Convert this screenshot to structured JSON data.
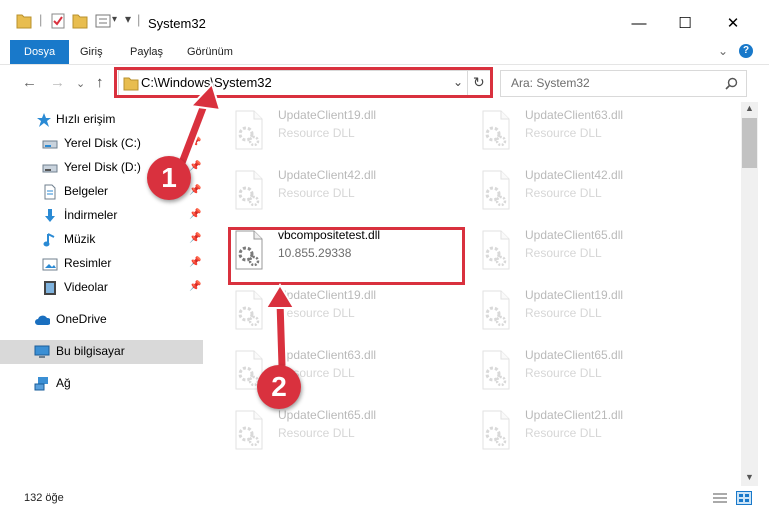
{
  "window": {
    "title": "System32",
    "minimize": "—",
    "maximize": "☐",
    "close": "✕"
  },
  "ribbon": {
    "tabs": [
      "Dosya",
      "Giriş",
      "Paylaş",
      "Görünüm"
    ],
    "help": "?"
  },
  "nav": {
    "back": "←",
    "forward": "→",
    "up": "↑",
    "recent": "⌄"
  },
  "address": {
    "path": "C:\\Windows\\System32"
  },
  "search": {
    "placeholder": "Ara: System32"
  },
  "sidebar": {
    "items": [
      {
        "label": "Hızlı erişim",
        "icon": "star-icon"
      },
      {
        "label": "Yerel Disk (C:)",
        "icon": "drive-icon"
      },
      {
        "label": "Yerel Disk (D:)",
        "icon": "drive-icon"
      },
      {
        "label": "Belgeler",
        "icon": "documents-icon"
      },
      {
        "label": "İndirmeler",
        "icon": "download-icon"
      },
      {
        "label": "Müzik",
        "icon": "music-icon"
      },
      {
        "label": "Resimler",
        "icon": "pictures-icon"
      },
      {
        "label": "Videolar",
        "icon": "video-icon"
      },
      {
        "label": "OneDrive",
        "icon": "cloud-icon"
      },
      {
        "label": "Bu bilgisayar",
        "icon": "computer-icon"
      },
      {
        "label": "Ağ",
        "icon": "network-icon"
      }
    ]
  },
  "files": [
    {
      "name": "UpdateClient19.dll",
      "type": "Resource DLL"
    },
    {
      "name": "UpdateClient63.dll",
      "type": "Resource DLL"
    },
    {
      "name": "UpdateClient42.dll",
      "type": "Resource DLL"
    },
    {
      "name": "UpdateClient42.dll",
      "type": "Resource DLL"
    },
    {
      "name": "vbcompositetest.dll",
      "type": "10.855.29338"
    },
    {
      "name": "UpdateClient65.dll",
      "type": "Resource DLL"
    },
    {
      "name": "UpdateClient19.dll",
      "type": "Resource DLL"
    },
    {
      "name": "UpdateClient19.dll",
      "type": "Resource DLL"
    },
    {
      "name": "UpdateClient63.dll",
      "type": "Resource DLL"
    },
    {
      "name": "UpdateClient65.dll",
      "type": "Resource DLL"
    },
    {
      "name": "UpdateClient65.dll",
      "type": "Resource DLL"
    },
    {
      "name": "UpdateClient21.dll",
      "type": "Resource DLL"
    }
  ],
  "status": {
    "count": "132 öğe"
  },
  "annotations": {
    "step1": "1",
    "step2": "2",
    "color": "#d9313e"
  }
}
